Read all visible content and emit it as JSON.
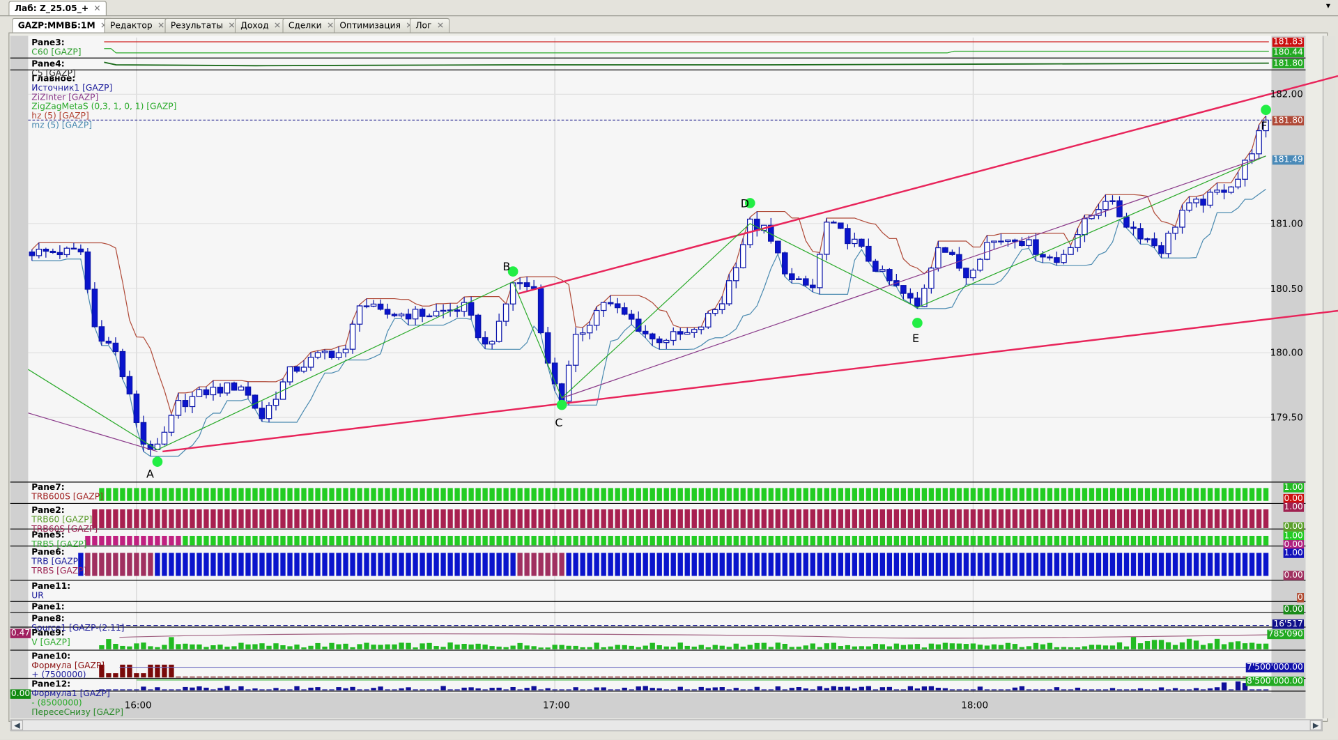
{
  "window": {
    "top_tab": "Лаб: Z_25.05_+",
    "menu_icon": "chevron-down-icon"
  },
  "tabs": [
    {
      "label": "GAZP:MMBБ:1M",
      "active": true
    },
    {
      "label": "Редактор"
    },
    {
      "label": "Результаты"
    },
    {
      "label": "Доход"
    },
    {
      "label": "Сделки"
    },
    {
      "label": "Оптимизация"
    },
    {
      "label": "Лог"
    }
  ],
  "legends": [
    {
      "pane": "Pane3:",
      "items": [
        {
          "text": "C60 [GAZP]",
          "color": "#2a9d2a"
        }
      ]
    },
    {
      "pane": "Pane4:",
      "items": [
        {
          "text": "C5 [GAZP]",
          "color": "#333333"
        }
      ]
    },
    {
      "pane": "Главное:",
      "items": [
        {
          "text": "Источник1 [GAZP]",
          "color": "#1a1a9a"
        },
        {
          "text": "ZiZInter [GAZP]",
          "color": "#8a3a8a"
        },
        {
          "text": "ZigZagMetaS (0,3, 1, 0, 1) [GAZP]",
          "color": "#2aaa2a"
        },
        {
          "text": "hz (5) [GAZP]",
          "color": "#b04030"
        },
        {
          "text": "mz (5) [GAZP]",
          "color": "#4a8ab0"
        }
      ]
    },
    {
      "pane": "Pane7:",
      "items": [
        {
          "text": "TRB600S [GAZP]",
          "color": "#a02020"
        }
      ]
    },
    {
      "pane": "Pane2:",
      "items": [
        {
          "text": "TRB60 [GAZP]",
          "color": "#5a9a2a"
        },
        {
          "text": "TRB60S [GAZP]",
          "color": "#9a2050"
        }
      ]
    },
    {
      "pane": "Pane5:",
      "items": [
        {
          "text": "TRB5 [GAZP]",
          "color": "#2aaa2a"
        }
      ]
    },
    {
      "pane": "Pane6:",
      "items": [
        {
          "text": "TRB [GAZP]",
          "color": "#1a1a9a"
        },
        {
          "text": "TRBS [GAZP]",
          "color": "#9a2050"
        }
      ]
    },
    {
      "pane": "Pane11:",
      "items": [
        {
          "text": "UR",
          "color": "#1a1a9a"
        }
      ]
    },
    {
      "pane": "Pane1:",
      "items": []
    },
    {
      "pane": "Pane8:",
      "items": [
        {
          "text": "Source1 [GAZP-(2.11]",
          "color": "#1a1a9a"
        }
      ]
    },
    {
      "pane": "Pane9:",
      "items": [
        {
          "text": "V [GAZP]",
          "color": "#2aaa2a"
        }
      ]
    },
    {
      "pane": "Pane10:",
      "items": [
        {
          "text": "Формула [GAZP]",
          "color": "#8a1010"
        },
        {
          "text": "+ (7500000)",
          "color": "#1a1a9a"
        }
      ]
    },
    {
      "pane": "Pane12:",
      "items": [
        {
          "text": "Формула1 [GAZP]",
          "color": "#1a1a9a"
        },
        {
          "text": "- (8500000)",
          "color": "#2aaa2a"
        },
        {
          "text": "ПересеСнизу [GAZP]",
          "color": "#2a8a2a"
        }
      ]
    }
  ],
  "price_labels": [
    {
      "text": "181.83",
      "bg": "#cc1010"
    },
    {
      "text": "180.44",
      "bg": "#22aa22"
    },
    {
      "text": "181.80",
      "bg": "#22aa22"
    },
    {
      "text": "182.00",
      "bg": ""
    },
    {
      "text": "181.80",
      "bg": "#b04a38"
    },
    {
      "text": "181.49",
      "bg": "#4a8ab8"
    },
    {
      "text": "181.00",
      "bg": ""
    },
    {
      "text": "180.50",
      "bg": ""
    },
    {
      "text": "180.00",
      "bg": ""
    },
    {
      "text": "179.50",
      "bg": ""
    },
    {
      "text": "1.00",
      "bg": "#22bb22"
    },
    {
      "text": "0.00",
      "bg": "#cc1010"
    },
    {
      "text": "1.00",
      "bg": "#a02050"
    },
    {
      "text": "0.00",
      "bg": "#5aa02a"
    },
    {
      "text": "1.00",
      "bg": "#22cc22"
    },
    {
      "text": "0.00",
      "bg": "#b02080"
    },
    {
      "text": "1.00",
      "bg": "#1010bb"
    },
    {
      "text": "0.00",
      "bg": "#a03060"
    },
    {
      "text": "0",
      "bg": "#b04a30"
    },
    {
      "text": "0.00",
      "bg": "#1a8a1a"
    },
    {
      "text": "16'517",
      "bg": "#10108a"
    },
    {
      "text": "785'090",
      "bg": "#22aa22"
    },
    {
      "text": "7'500'000.00",
      "bg": "#1010aa"
    },
    {
      "text": "8'500'000.00",
      "bg": "#22aa22"
    }
  ],
  "left_labels": [
    {
      "text": "0.47",
      "bg": "#a02060"
    },
    {
      "text": "0.00",
      "bg": "#108a10"
    }
  ],
  "time_ticks": [
    "16:00",
    "17:00",
    "18:00"
  ],
  "points": [
    "A",
    "B",
    "C",
    "D",
    "E",
    "F"
  ],
  "chart_data": {
    "type": "candlestick",
    "symbol": "GAZP:MMBБ:1M",
    "ylim": [
      179.2,
      182.2
    ],
    "yticks": [
      179.5,
      180.0,
      180.5,
      181.0,
      182.0
    ],
    "xticks": [
      "16:00",
      "17:00",
      "18:00"
    ],
    "x_range": [
      "15:45",
      "18:42"
    ],
    "close_keypoints": [
      [
        "15:45",
        180.78
      ],
      [
        "15:52",
        180.78
      ],
      [
        "15:54",
        180.2
      ],
      [
        "15:57",
        180.0
      ],
      [
        "15:59",
        179.65
      ],
      [
        "16:01",
        179.3
      ],
      [
        "16:03",
        179.25
      ],
      [
        "16:06",
        179.6
      ],
      [
        "16:10",
        179.7
      ],
      [
        "16:15",
        179.75
      ],
      [
        "16:18",
        179.5
      ],
      [
        "16:22",
        179.85
      ],
      [
        "16:27",
        180.0
      ],
      [
        "16:30",
        180.0
      ],
      [
        "16:32",
        180.4
      ],
      [
        "16:35",
        180.3
      ],
      [
        "16:42",
        180.3
      ],
      [
        "16:47",
        180.35
      ],
      [
        "16:50",
        180.05
      ],
      [
        "16:52",
        180.2
      ],
      [
        "16:54",
        180.55
      ],
      [
        "16:57",
        180.5
      ],
      [
        "16:59",
        179.9
      ],
      [
        "17:01",
        179.65
      ],
      [
        "17:03",
        180.1
      ],
      [
        "17:07",
        180.4
      ],
      [
        "17:11",
        180.25
      ],
      [
        "17:14",
        180.1
      ],
      [
        "17:20",
        180.15
      ],
      [
        "17:24",
        180.4
      ],
      [
        "17:28",
        181.0
      ],
      [
        "17:30",
        180.95
      ],
      [
        "17:34",
        180.55
      ],
      [
        "17:37",
        180.5
      ],
      [
        "17:39",
        181.0
      ],
      [
        "17:43",
        180.85
      ],
      [
        "17:47",
        180.6
      ],
      [
        "17:52",
        180.35
      ],
      [
        "17:55",
        180.85
      ],
      [
        "17:59",
        180.6
      ],
      [
        "18:02",
        180.85
      ],
      [
        "18:06",
        180.9
      ],
      [
        "18:12",
        180.7
      ],
      [
        "18:16",
        181.0
      ],
      [
        "18:19",
        181.2
      ],
      [
        "18:22",
        181.0
      ],
      [
        "18:27",
        180.8
      ],
      [
        "18:30",
        181.1
      ],
      [
        "18:34",
        181.2
      ],
      [
        "18:38",
        181.35
      ],
      [
        "18:42",
        181.8
      ]
    ],
    "pivots": [
      {
        "label": "A",
        "time": "16:03",
        "price": 179.25
      },
      {
        "label": "B",
        "time": "16:54",
        "price": 180.55
      },
      {
        "label": "C",
        "time": "17:01",
        "price": 179.65
      },
      {
        "label": "D",
        "time": "17:28",
        "price": 181.0
      },
      {
        "label": "E",
        "time": "17:52",
        "price": 180.35
      },
      {
        "label": "F",
        "time": "18:42",
        "price": 181.8
      }
    ],
    "last_price": 181.8,
    "trb6_segments": [
      [
        "15:53",
        "16:03",
        "#a03060"
      ],
      [
        "16:03",
        "16:55",
        "#0a14cc"
      ],
      [
        "16:55",
        "17:02",
        "#a03060"
      ],
      [
        "17:02",
        "18:42",
        "#0a14cc"
      ]
    ],
    "trb5_segments": [
      [
        "15:53",
        "16:07",
        "#c02080"
      ],
      [
        "16:07",
        "18:42",
        "#22cc22"
      ]
    ]
  },
  "colors": {
    "up_candle": "#ffffff",
    "down_candle": "#0a14cc",
    "trend": "#e8245a",
    "zigzag": "#2aaa2a",
    "zizinter": "#8a3a8a",
    "hz": "#b04a38",
    "mz": "#4a8ab0",
    "pivot": "#22ee44"
  }
}
